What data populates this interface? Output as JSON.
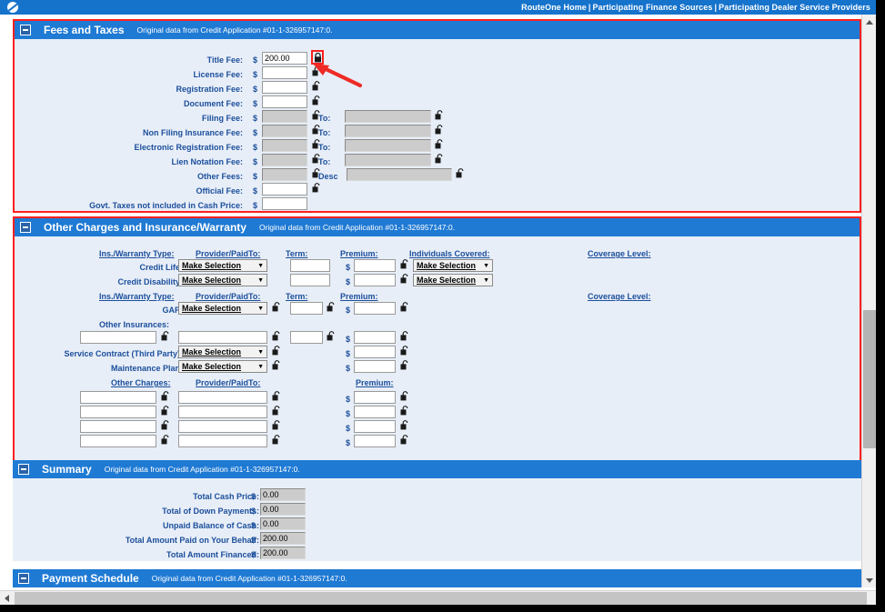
{
  "topnav": {
    "logo_name": "routeone-logo",
    "links": [
      {
        "label": "RouteOne Home"
      },
      {
        "label": "Participating Finance Sources"
      },
      {
        "label": "Participating Dealer Service Providers"
      }
    ],
    "separator": "|"
  },
  "common": {
    "note": "Original data from Credit Application #01-1-326957147:0.",
    "dollar": "$",
    "make_selection": "Make Selection",
    "caret": "▼",
    "to_label": "To:",
    "desc_label": "Desc"
  },
  "sections": {
    "fees_and_taxes": {
      "title": "Fees and Taxes",
      "note": "Original data from Credit Application #01-1-326957147:0.",
      "rows": [
        {
          "label": "Title Fee:",
          "value": "200.00",
          "readonly": false,
          "locked": true,
          "highlighted": true
        },
        {
          "label": "License Fee:",
          "value": "",
          "readonly": false,
          "locked": false
        },
        {
          "label": "Registration Fee:",
          "value": "",
          "readonly": false,
          "locked": false
        },
        {
          "label": "Document Fee:",
          "value": "",
          "readonly": false,
          "locked": false
        },
        {
          "label": "Filing Fee:",
          "value": "",
          "readonly": true,
          "locked": false,
          "to_value": ""
        },
        {
          "label": "Non Filing Insurance Fee:",
          "value": "",
          "readonly": true,
          "locked": false,
          "to_value": ""
        },
        {
          "label": "Electronic Registration Fee:",
          "value": "",
          "readonly": true,
          "locked": false,
          "to_value": ""
        },
        {
          "label": "Lien Notation Fee:",
          "value": "",
          "readonly": true,
          "locked": false,
          "to_value": ""
        },
        {
          "label": "Other Fees:",
          "value": "",
          "readonly": true,
          "locked": false,
          "desc_value": ""
        },
        {
          "label": "Official Fee:",
          "value": "",
          "readonly": false,
          "locked": false
        },
        {
          "label": "Govt. Taxes not included in Cash Price:",
          "value": "",
          "readonly": false,
          "locked": false
        }
      ]
    },
    "other_charges": {
      "title": "Other Charges and Insurance/Warranty",
      "note": "Original data from Credit Application #01-1-326957147:0.",
      "headers_group1": {
        "type": "Ins./Warranty Type:",
        "provider": "Provider/PaidTo:",
        "term": "Term:",
        "premium": "Premium:",
        "individuals": "Individuals Covered:",
        "coverage": "Coverage Level:"
      },
      "headers_group2": {
        "type": "Ins./Warranty Type:",
        "provider": "Provider/PaidTo:",
        "term": "Term:",
        "premium": "Premium:",
        "coverage": "Coverage Level:"
      },
      "headers_group3": {
        "other_charges": "Other Charges:",
        "provider": "Provider/PaidTo:",
        "premium": "Premium:"
      },
      "credit_life": {
        "label": "Credit Life:",
        "provider": "Make Selection",
        "term": "",
        "premium": "",
        "individuals": "Make Selection"
      },
      "credit_disability": {
        "label": "Credit Disability:",
        "provider": "Make Selection",
        "term": "",
        "premium": "",
        "individuals": "Make Selection"
      },
      "gap": {
        "label": "GAP:",
        "provider": "Make Selection",
        "term": "",
        "premium": ""
      },
      "other_insurances": {
        "label": "Other Insurances:",
        "name": "",
        "provider": "",
        "term": "",
        "premium": ""
      },
      "service_contract": {
        "label": "Service Contract (Third Party):",
        "provider": "Make Selection",
        "premium": ""
      },
      "maintenance_plan": {
        "label": "Maintenance Plan:",
        "provider": "Make Selection",
        "premium": ""
      },
      "charge_rows": [
        {
          "charge": "",
          "provider": "",
          "premium": ""
        },
        {
          "charge": "",
          "provider": "",
          "premium": ""
        },
        {
          "charge": "",
          "provider": "",
          "premium": ""
        },
        {
          "charge": "",
          "provider": "",
          "premium": ""
        }
      ]
    },
    "summary": {
      "title": "Summary",
      "note": "Original data from Credit Application #01-1-326957147:0.",
      "rows": [
        {
          "label": "Total Cash Price:",
          "value": "0.00"
        },
        {
          "label": "Total of Down Payments:",
          "value": "0.00"
        },
        {
          "label": "Unpaid Balance of Cash:",
          "value": "0.00"
        },
        {
          "label": "Total Amount Paid on Your Behalf:",
          "value": "200.00"
        },
        {
          "label": "Total Amount Financed:",
          "value": "200.00"
        }
      ]
    },
    "payment_schedule": {
      "title": "Payment Schedule",
      "note": "Original data from Credit Application #01-1-326957147:0."
    }
  },
  "annotation": {
    "arrow_name": "red-pointer-arrow",
    "target": "Title Fee lock toggle",
    "color": "#ff2020"
  },
  "scrollbars": {
    "vertical": {
      "up": "▲",
      "down": "▼"
    },
    "horizontal": {
      "left": "◀",
      "right": "▶"
    }
  },
  "colors": {
    "header_blue": "#1f7ad4",
    "nav_blue": "#1673cc",
    "panel_bg": "#e8eef7",
    "label_blue": "#1b4f9c",
    "flag_red": "#ff2020"
  }
}
